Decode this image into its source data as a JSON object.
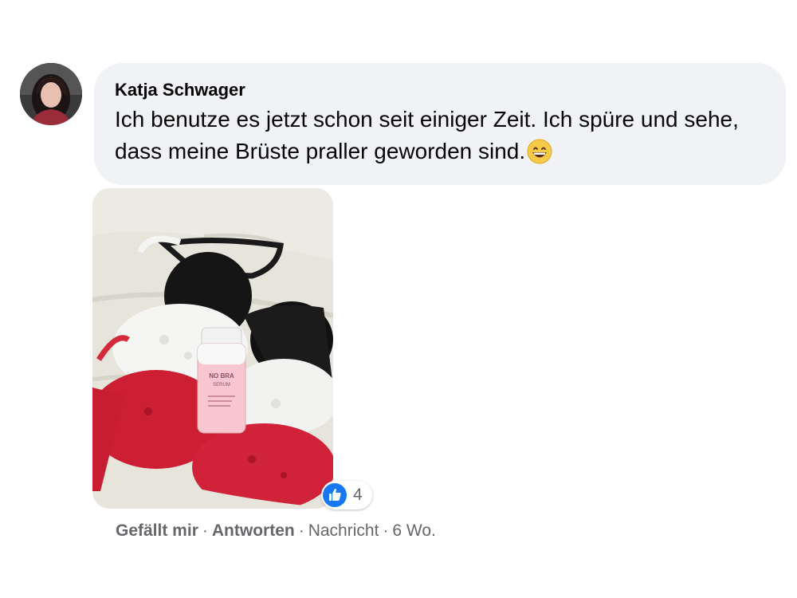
{
  "comment": {
    "author": "Katja Schwager",
    "text": "Ich benutze es jetzt schon seit einiger Zeit. Ich spüre und sehe, dass meine Brüste praller geworden sind.",
    "emoji": "grinning-face-emoji"
  },
  "photo": {
    "product_label": {
      "line1": "NO BRA",
      "line2": "SERUM"
    }
  },
  "reactions": {
    "icon": "like-icon",
    "count": "4",
    "color": "#1877f2"
  },
  "actions": {
    "like": "Gefällt mir",
    "reply": "Antworten",
    "message": "Nachricht",
    "time": "6 Wo.",
    "separator": "·"
  },
  "colors": {
    "bubble": "#f0f2f5",
    "secondary_text": "#65676b",
    "primary_text": "#050505"
  }
}
